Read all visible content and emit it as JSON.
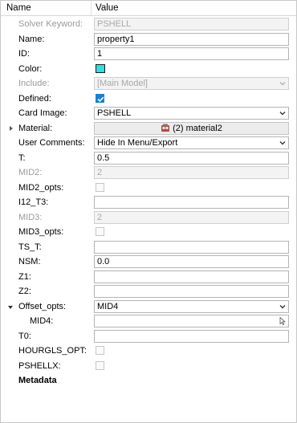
{
  "header": {
    "name": "Name",
    "value": "Value"
  },
  "colors": {
    "swatch": "#2ee0e0",
    "accent": "#1a80d4"
  },
  "rows": {
    "solver_keyword": {
      "label": "Solver Keyword:",
      "value": "PSHELL"
    },
    "name": {
      "label": "Name:",
      "value": "property1"
    },
    "id": {
      "label": "ID:",
      "value": "1"
    },
    "color": {
      "label": "Color:"
    },
    "include": {
      "label": "Include:",
      "value": "[Main Model]"
    },
    "defined": {
      "label": "Defined:",
      "checked": true
    },
    "card_image": {
      "label": "Card Image:",
      "value": "PSHELL"
    },
    "material": {
      "label": "Material:",
      "value": "(2) material2",
      "icon": "material-icon"
    },
    "user_comments": {
      "label": "User Comments:",
      "value": "Hide In Menu/Export"
    },
    "t": {
      "label": "T:",
      "value": "0.5"
    },
    "mid2": {
      "label": "MID2:",
      "value": "2"
    },
    "mid2_opts": {
      "label": "MID2_opts:",
      "checked": false
    },
    "i12_t3": {
      "label": "I12_T3:",
      "value": ""
    },
    "mid3": {
      "label": "MID3:",
      "value": "2"
    },
    "mid3_opts": {
      "label": "MID3_opts:",
      "checked": false
    },
    "ts_t": {
      "label": "TS_T:",
      "value": ""
    },
    "nsm": {
      "label": "NSM:",
      "value": "0.0"
    },
    "z1": {
      "label": "Z1:",
      "value": ""
    },
    "z2": {
      "label": "Z2:",
      "value": ""
    },
    "offset_opts": {
      "label": "Offset_opts:",
      "value": "MID4"
    },
    "mid4": {
      "label": "MID4:",
      "value": ""
    },
    "t0": {
      "label": "T0:",
      "value": ""
    },
    "hourgls_opt": {
      "label": "HOURGLS_OPT:",
      "checked": false
    },
    "pshellx": {
      "label": "PSHELLX:",
      "checked": false
    },
    "metadata": {
      "label": "Metadata"
    }
  }
}
